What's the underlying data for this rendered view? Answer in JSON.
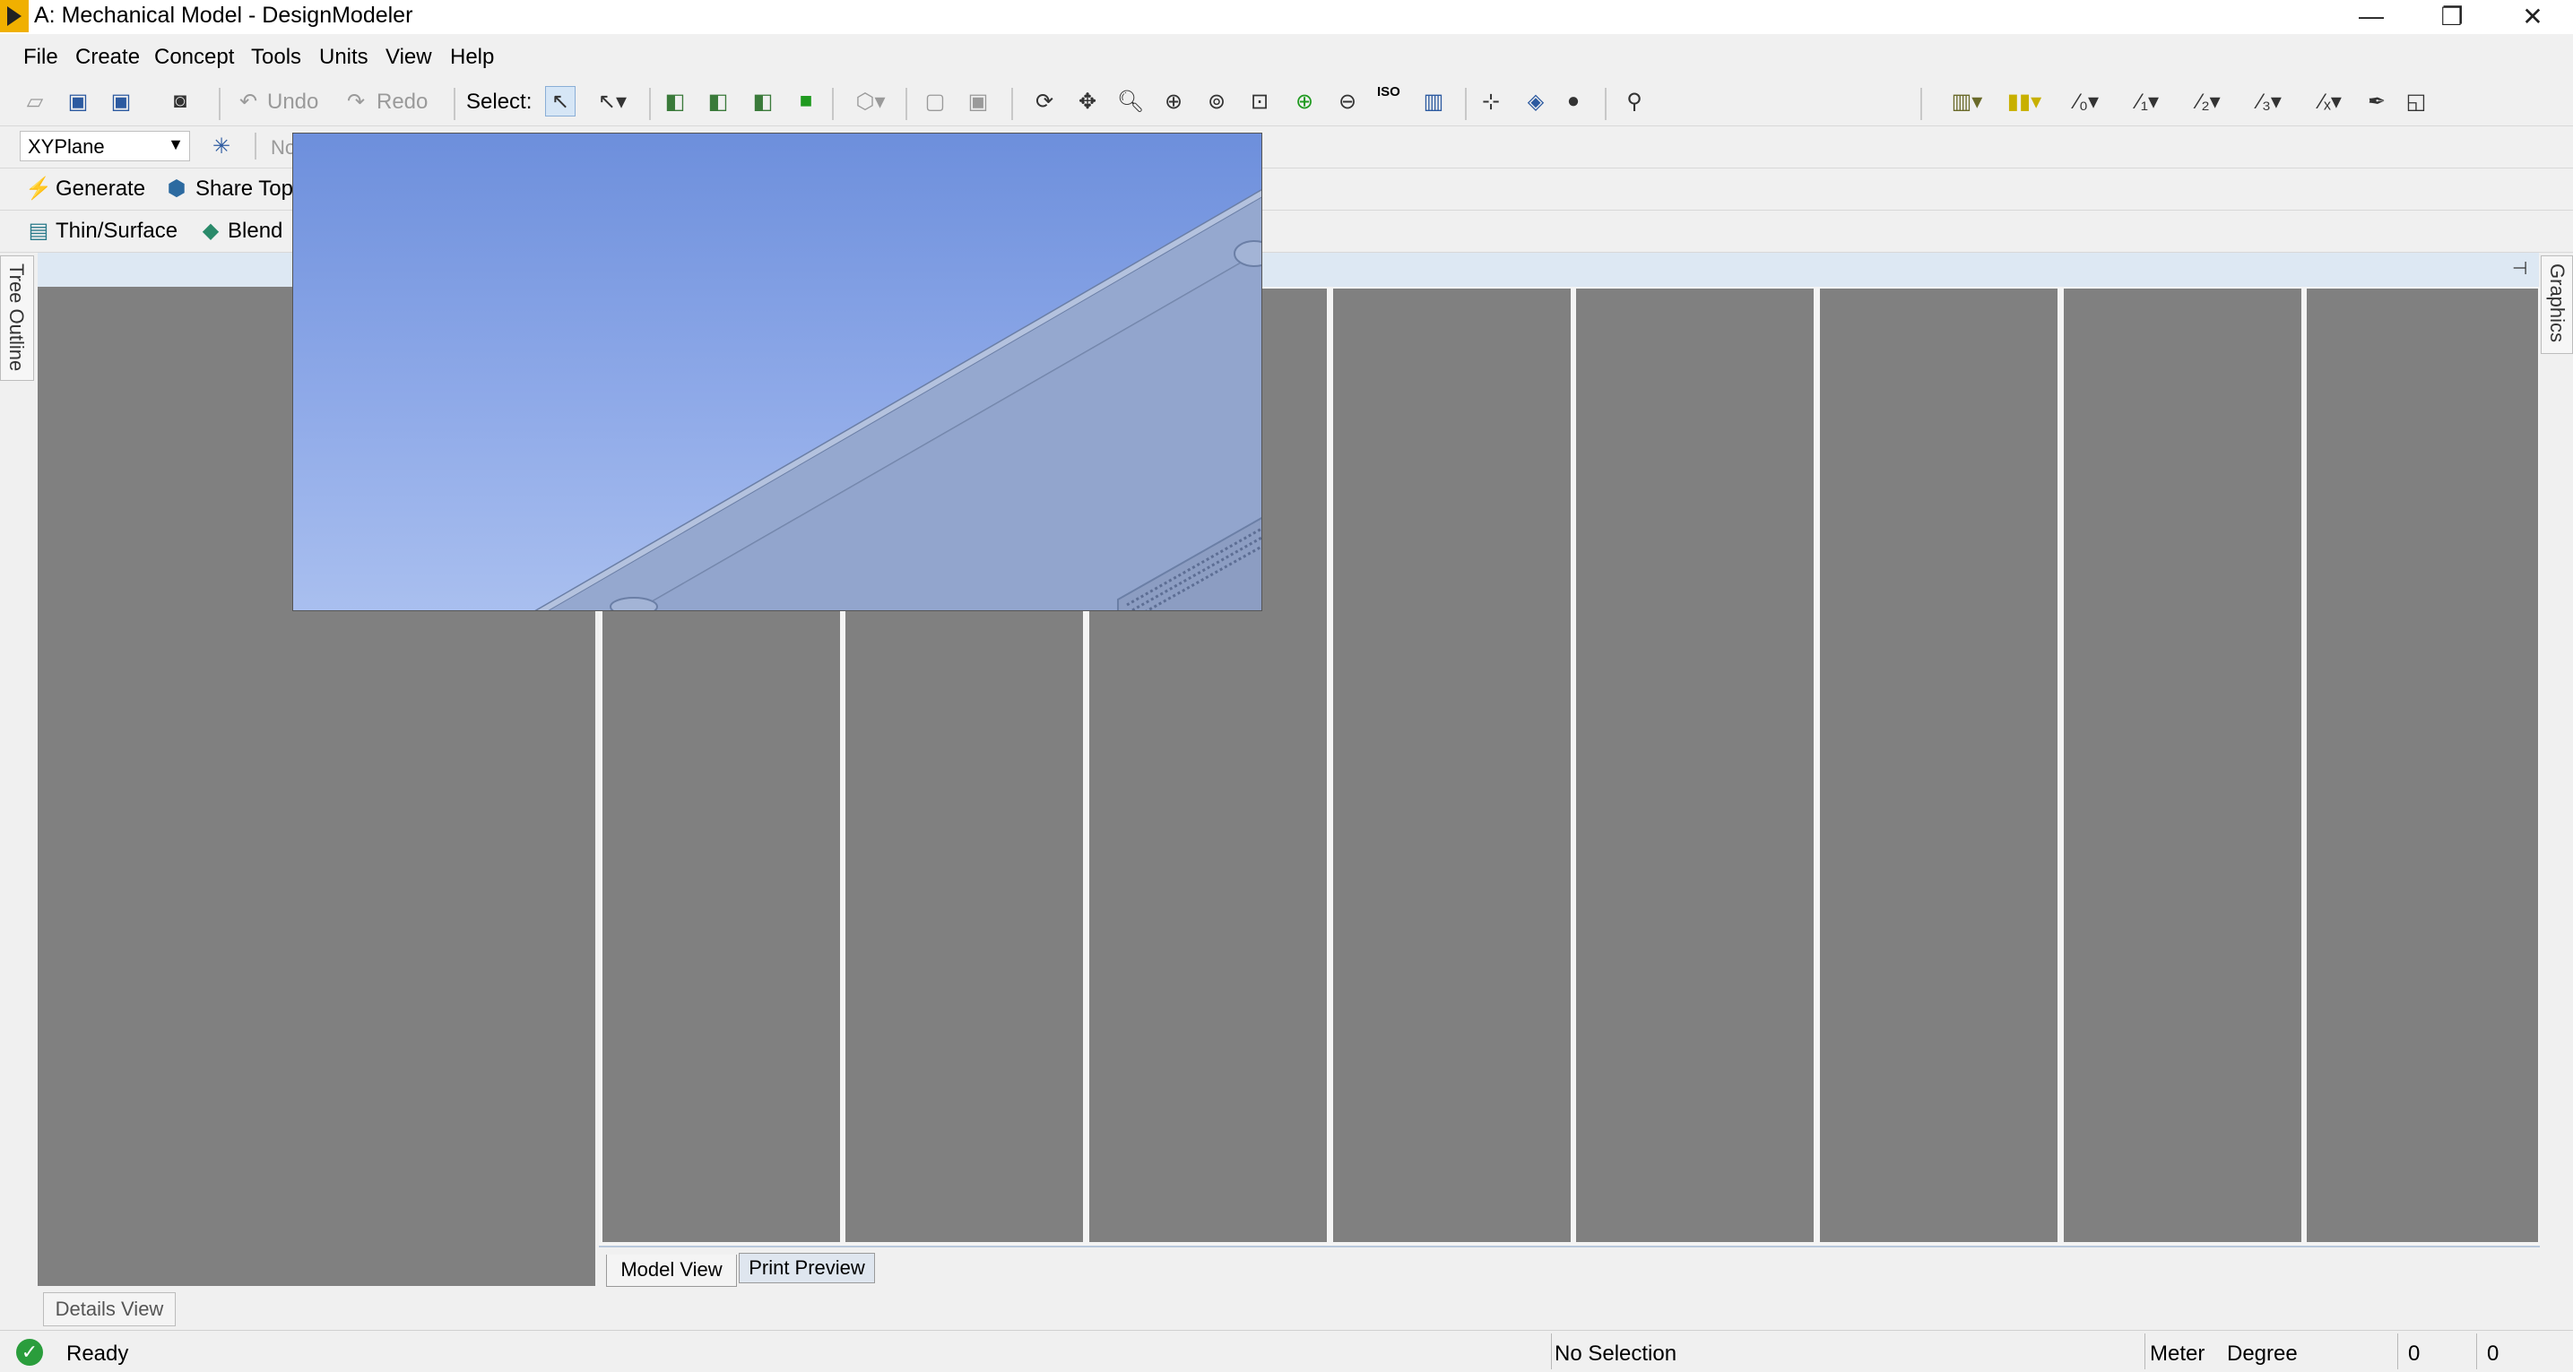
{
  "window": {
    "title": "A: Mechanical Model - DesignModeler",
    "minimize": "—",
    "restore": "❐",
    "close": "✕"
  },
  "menu": [
    "File",
    "Create",
    "Concept",
    "Tools",
    "Units",
    "View",
    "Help"
  ],
  "toolbar1": {
    "undo_label": "Undo",
    "redo_label": "Redo",
    "select_label": "Select:",
    "iso_label": "ISO"
  },
  "toolbar2": {
    "plane": "XYPlane",
    "sketch_partial": "No"
  },
  "toolbar3": {
    "generate_label": "Generate",
    "share_topology_label": "Share Topo"
  },
  "toolbar4": {
    "thin_surface_label": "Thin/Surface",
    "blend_label": "Blend"
  },
  "side_tabs": {
    "tree_outline": "Tree Outline",
    "graphics": "Graphics"
  },
  "view_tabs": {
    "model_view": "Model View",
    "print_preview": "Print Preview"
  },
  "details_view": "Details View",
  "status": {
    "state": "Ready",
    "selection": "No Selection",
    "length_unit": "Meter",
    "angle_unit": "Degree",
    "value1": "0",
    "value2": "0"
  },
  "colors": {
    "panel_grey": "#808080",
    "viewport_top": "#6d8fdc",
    "viewport_bottom": "#a9bfef",
    "accent_yellow": "#f0b000",
    "status_green": "#2a9d3c"
  }
}
